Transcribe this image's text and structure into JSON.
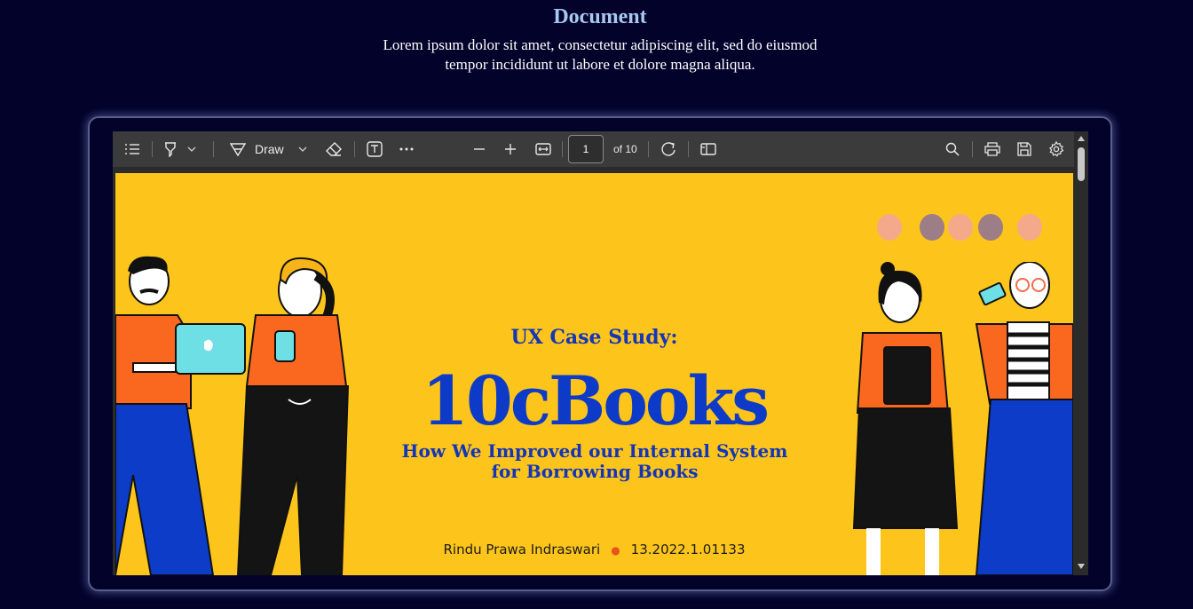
{
  "page": {
    "title": "Document",
    "description": "Lorem ipsum dolor sit amet, consectetur adipiscing elit, sed do eiusmod tempor incididunt ut labore et dolore magna aliqua."
  },
  "toolbar": {
    "draw_label": "Draw",
    "current_page": "1",
    "page_count_label": "of 10",
    "icons": [
      "contents-icon",
      "highlight-icon",
      "draw-icon",
      "eraser-icon",
      "text-box-icon",
      "more-icon",
      "zoom-out-icon",
      "zoom-in-icon",
      "fit-width-icon",
      "rotate-icon",
      "page-view-icon",
      "search-icon",
      "print-icon",
      "save-icon",
      "settings-icon"
    ]
  },
  "slide": {
    "kicker": "UX Case Study:",
    "title": "10cBooks",
    "tagline": "How We Improved our Internal System for Borrowing Books",
    "author": "Rindu Prawa Indraswari",
    "student_id": "13.2022.1.01133",
    "background": "#fdc51b",
    "accent": "#0d3bc7"
  }
}
